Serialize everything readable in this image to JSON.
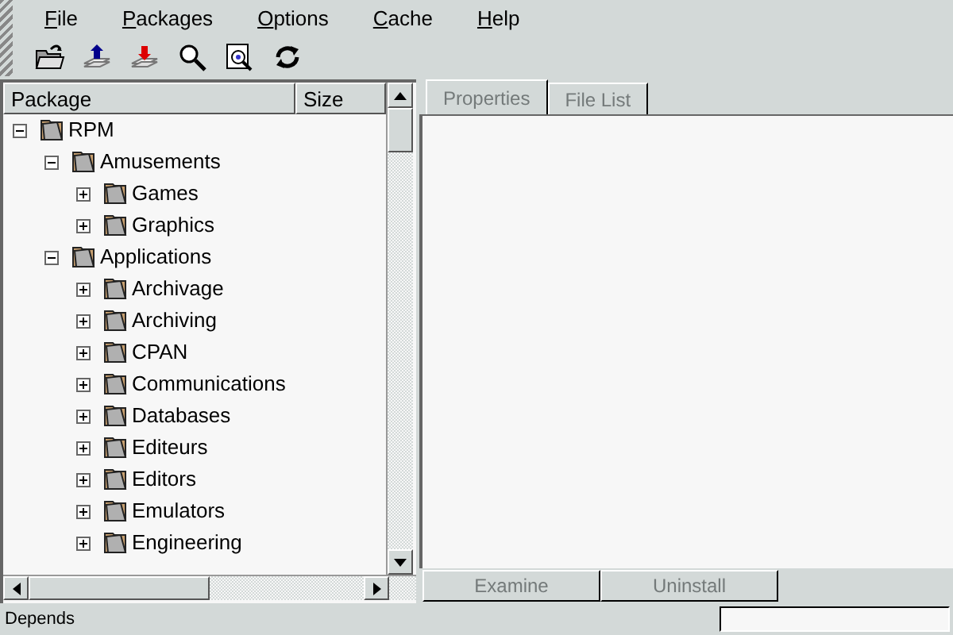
{
  "menu": [
    "File",
    "Packages",
    "Options",
    "Cache",
    "Help"
  ],
  "toolbar": [
    {
      "kind": "open"
    },
    {
      "kind": "install"
    },
    {
      "kind": "uninstall"
    },
    {
      "kind": "find"
    },
    {
      "kind": "query"
    },
    {
      "kind": "refresh"
    }
  ],
  "tree": {
    "columns": [
      "Package",
      "Size"
    ],
    "nodes": [
      {
        "label": "RPM",
        "expanded": true,
        "children": [
          {
            "label": "Amusements",
            "expanded": true,
            "children": [
              {
                "label": "Games",
                "expanded": false
              },
              {
                "label": "Graphics",
                "expanded": false
              }
            ]
          },
          {
            "label": "Applications",
            "expanded": true,
            "children": [
              {
                "label": "Archivage",
                "expanded": false
              },
              {
                "label": "Archiving",
                "expanded": false
              },
              {
                "label": "CPAN",
                "expanded": false
              },
              {
                "label": "Communications",
                "expanded": false
              },
              {
                "label": "Databases",
                "expanded": false
              },
              {
                "label": "Editeurs",
                "expanded": false
              },
              {
                "label": "Editors",
                "expanded": false
              },
              {
                "label": "Emulators",
                "expanded": false
              },
              {
                "label": "Engineering",
                "expanded": false
              }
            ]
          }
        ]
      }
    ]
  },
  "tabs": [
    {
      "label": "Properties",
      "selected": true,
      "disabled": true
    },
    {
      "label": "File List",
      "selected": false,
      "disabled": true
    }
  ],
  "buttons": [
    {
      "label": "Examine",
      "disabled": true
    },
    {
      "label": "Uninstall",
      "disabled": true
    }
  ],
  "status_bar": {
    "text": "Depends"
  }
}
